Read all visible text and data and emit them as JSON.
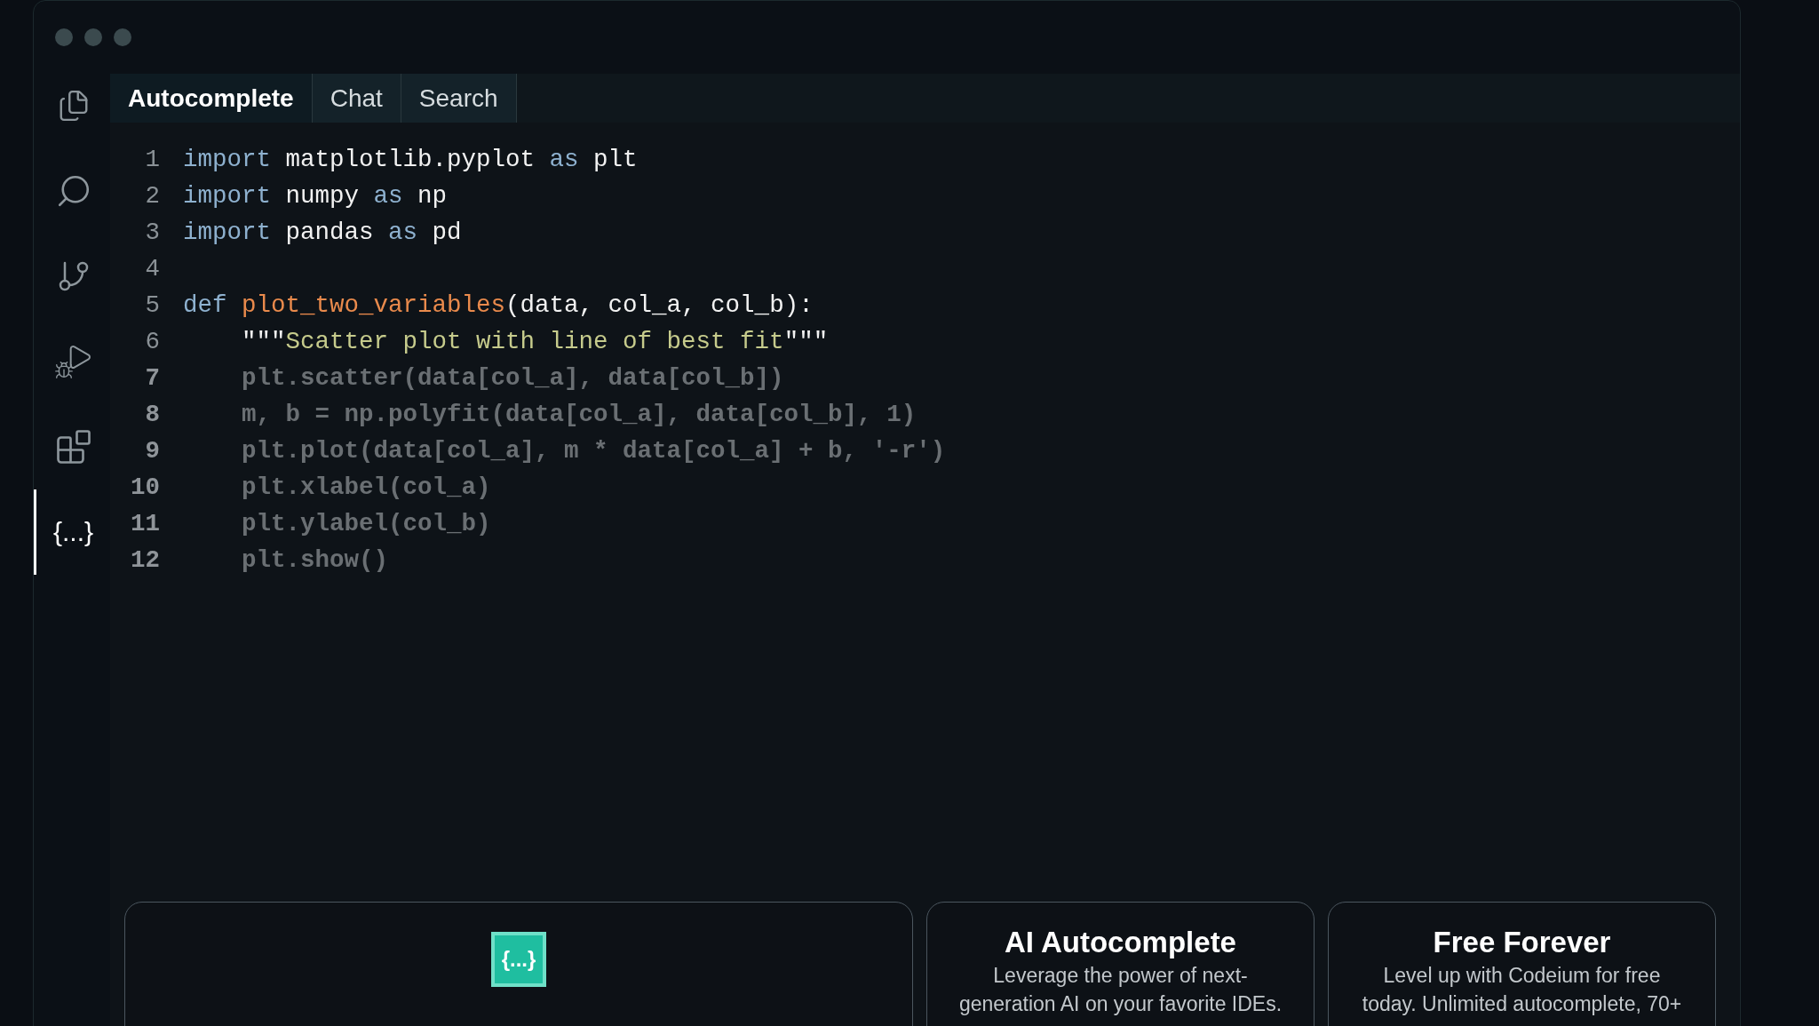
{
  "sidebar": {
    "items": [
      {
        "kind": "files",
        "selected": false
      },
      {
        "kind": "search",
        "selected": false
      },
      {
        "kind": "branch",
        "selected": false
      },
      {
        "kind": "debug",
        "selected": false
      },
      {
        "kind": "extensions",
        "selected": false
      },
      {
        "kind": "braces",
        "label": "{...}",
        "selected": true
      }
    ]
  },
  "tabs": [
    {
      "label": "Autocomplete",
      "selected": true
    },
    {
      "label": "Chat",
      "selected": false
    },
    {
      "label": "Search",
      "selected": false
    }
  ],
  "editor": {
    "lines": [
      {
        "number": "1",
        "suggested": false,
        "tokens": [
          {
            "text": "import",
            "kind": "keyword"
          },
          {
            "text": " matplotlib.pyplot ",
            "kind": "plain"
          },
          {
            "text": "as",
            "kind": "keyword"
          },
          {
            "text": " plt",
            "kind": "plain"
          }
        ]
      },
      {
        "number": "2",
        "suggested": false,
        "tokens": [
          {
            "text": "import",
            "kind": "keyword"
          },
          {
            "text": " numpy ",
            "kind": "plain"
          },
          {
            "text": "as",
            "kind": "keyword"
          },
          {
            "text": " np",
            "kind": "plain"
          }
        ]
      },
      {
        "number": "3",
        "suggested": false,
        "tokens": [
          {
            "text": "import",
            "kind": "keyword"
          },
          {
            "text": " pandas ",
            "kind": "plain"
          },
          {
            "text": "as",
            "kind": "keyword"
          },
          {
            "text": " pd",
            "kind": "plain"
          }
        ]
      },
      {
        "number": "4",
        "suggested": false
      },
      {
        "number": "5",
        "suggested": false,
        "tokens": [
          {
            "text": "def ",
            "kind": "keyword"
          },
          {
            "text": "plot_two_variables",
            "kind": "function"
          },
          {
            "text": "(data, col_a, col_b):",
            "kind": "plain"
          }
        ]
      },
      {
        "number": "6",
        "suggested": false,
        "tokens": [
          {
            "text": "    \"\"\"",
            "kind": "plain"
          },
          {
            "text": "Scatter plot with line of best fit",
            "kind": "string"
          },
          {
            "text": "\"\"\"",
            "kind": "plain"
          }
        ]
      },
      {
        "number": "7",
        "suggested": true,
        "text": "    plt.scatter(data[col_a], data[col_b])"
      },
      {
        "number": "8",
        "suggested": true,
        "text": "    m, b = np.polyfit(data[col_a], data[col_b], 1)"
      },
      {
        "number": "9",
        "suggested": true,
        "text": "    plt.plot(data[col_a], m * data[col_a] + b, '-r')"
      },
      {
        "number": "10",
        "suggested": true,
        "text": "    plt.xlabel(col_a)"
      },
      {
        "number": "11",
        "suggested": true,
        "text": "    plt.ylabel(col_b)"
      },
      {
        "number": "12",
        "suggested": true,
        "text": "    plt.show()"
      }
    ]
  },
  "cards": [
    {
      "kind": "logo",
      "logo": "{...}"
    },
    {
      "kind": "text",
      "title": "AI Autocomplete",
      "description": [
        "Leverage the power of next-",
        "generation AI on your favorite IDEs."
      ]
    },
    {
      "kind": "text",
      "title": "Free Forever",
      "description": [
        "Level up with Codeium for free",
        "today. Unlimited autocomplete, 70+"
      ]
    }
  ]
}
